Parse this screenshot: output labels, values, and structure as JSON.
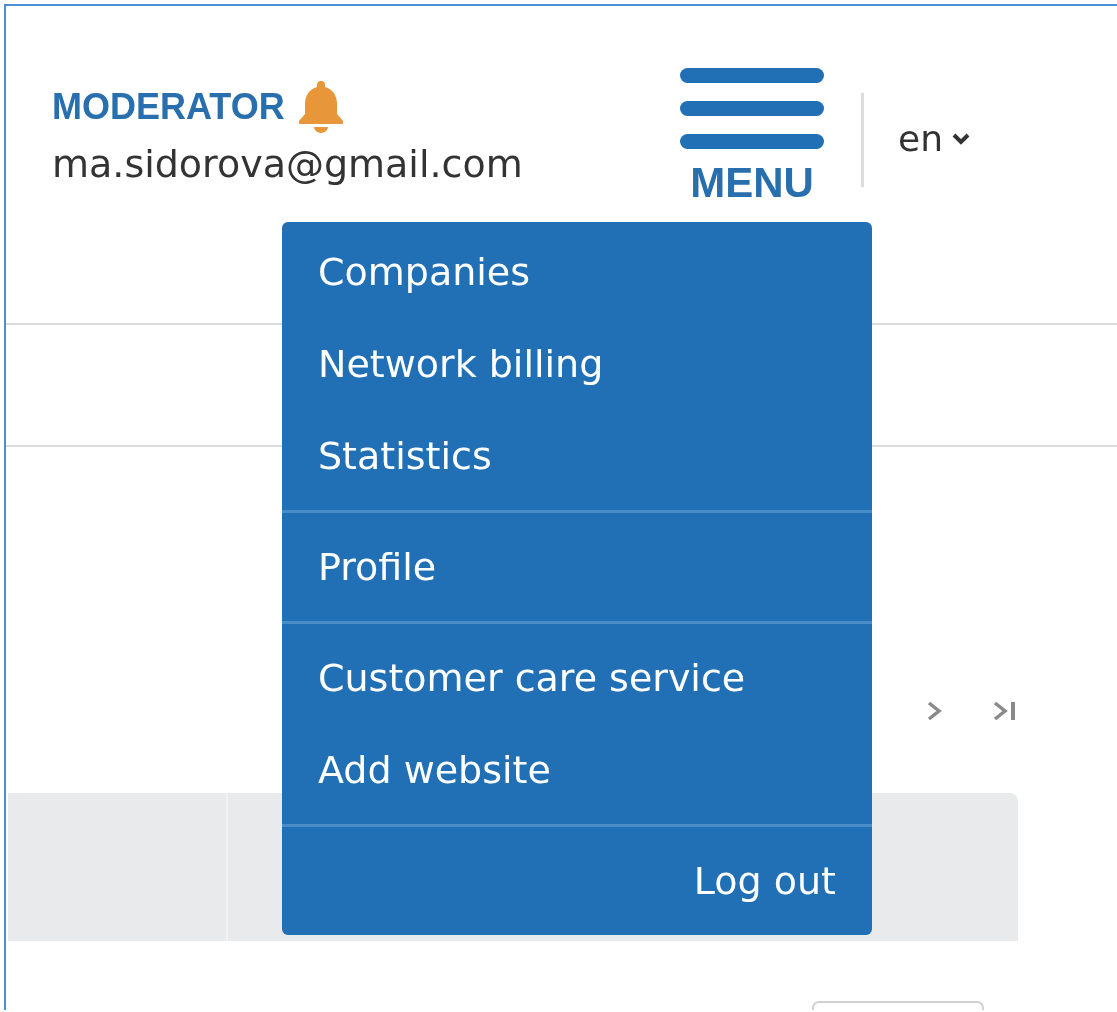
{
  "user": {
    "role": "MODERATOR",
    "notifications": true,
    "email": "ma.sidorova@gmail.com"
  },
  "menu_button": {
    "label": "MENU",
    "expanded": true
  },
  "language": {
    "value": "en"
  },
  "menu": {
    "sections": [
      {
        "items": [
          {
            "kind": "link",
            "label": "Companies"
          },
          {
            "kind": "link",
            "label": "Network billing"
          },
          {
            "kind": "link",
            "label": "Statistics"
          }
        ]
      },
      {
        "items": [
          {
            "kind": "link",
            "label": "Profile"
          }
        ]
      },
      {
        "items": [
          {
            "kind": "link",
            "label": "Customer care service"
          },
          {
            "kind": "link",
            "label": "Add website"
          }
        ]
      },
      {
        "items": [
          {
            "kind": "action",
            "label": "Log out"
          }
        ]
      }
    ]
  },
  "pagination": {
    "controls": [
      {
        "kind": "next"
      },
      {
        "kind": "last"
      }
    ]
  }
}
